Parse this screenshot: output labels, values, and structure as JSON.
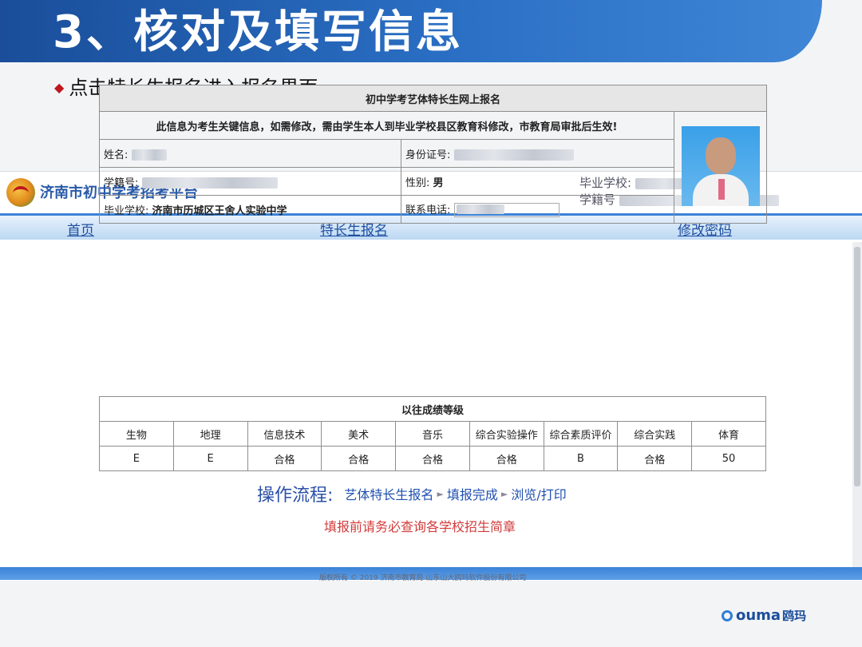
{
  "slide": {
    "title": "3、核对及填写信息",
    "bullet": "点击特长生报名进入报名界面"
  },
  "site": {
    "name": "济南市初中学考招考平台",
    "grad_school_label": "毕业学校:",
    "student_no_label": "学籍号",
    "nav": [
      "首页",
      "特长生报名",
      "修改密码"
    ]
  },
  "form": {
    "title": "初中学考艺体特长生网上报名",
    "notice": "此信息为考生关键信息，如需修改，需由学生本人到毕业学校县区教育科修改，市教育局审批后生效!",
    "name_label": "姓名:",
    "id_label": "身份证号:",
    "student_no_label": "学籍号:",
    "gender_label": "性别:",
    "gender_value": "男",
    "school_label": "毕业学校:",
    "school_value": "济南市历城区王舍人实验中学",
    "phone_label": "联系电话:"
  },
  "grades": {
    "title": "以往成绩等级",
    "headers": [
      "生物",
      "地理",
      "信息技术",
      "美术",
      "音乐",
      "综合实验操作",
      "综合素质评价",
      "综合实践",
      "体育"
    ],
    "values": [
      "E",
      "E",
      "合格",
      "合格",
      "合格",
      "合格",
      "B",
      "合格",
      "50"
    ]
  },
  "process": {
    "label": "操作流程:",
    "steps": [
      "艺体特长生报名",
      "填报完成",
      "浏览/打印"
    ]
  },
  "reminder": "填报前请务必查询各学校招生简章",
  "footer": "版权所有 © 2019 济南市教育局 山东山大鸥玛软件股份有限公司",
  "brand": {
    "latin": "ouma",
    "cn": "鸥玛"
  }
}
